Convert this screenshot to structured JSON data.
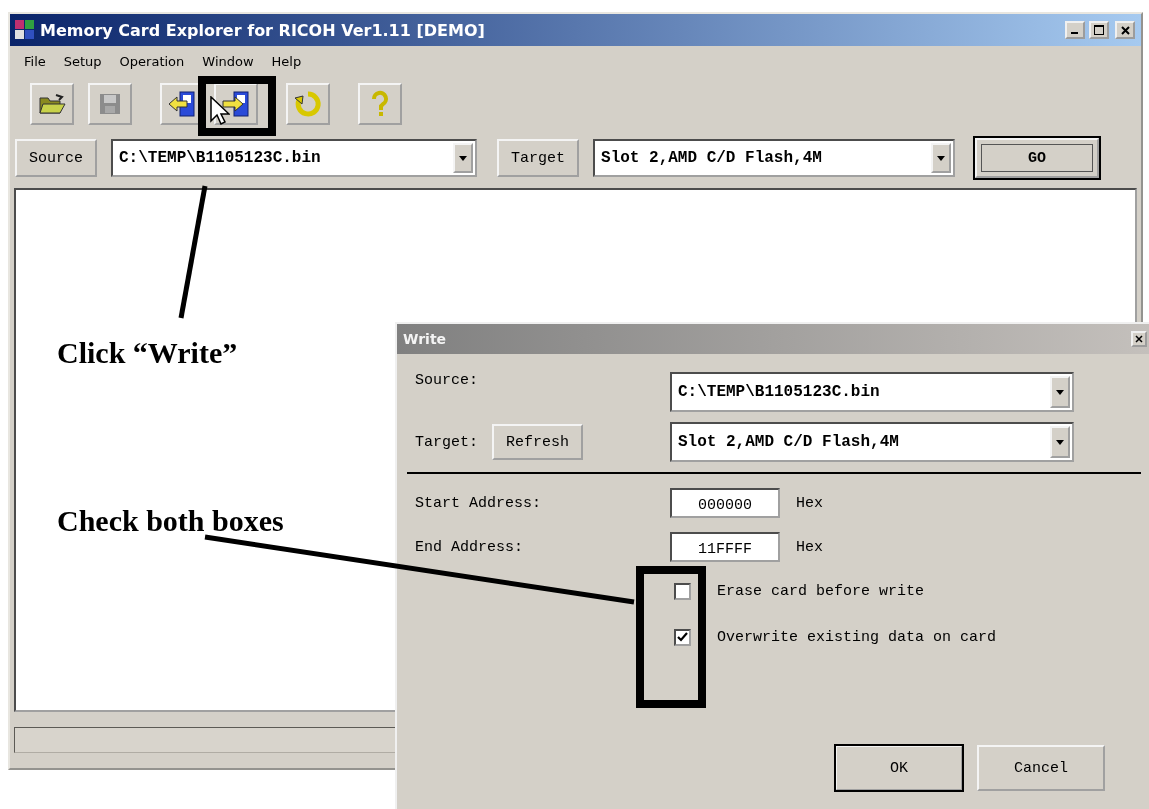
{
  "window": {
    "title": "Memory Card Explorer for RICOH Ver1.11 [DEMO]"
  },
  "menu": [
    "File",
    "Setup",
    "Operation",
    "Window",
    "Help"
  ],
  "toolbar": [
    {
      "disabled": false
    },
    {
      "disabled": true
    },
    {
      "disabled": false
    },
    {
      "disabled": false
    },
    {
      "disabled": false
    },
    {
      "disabled": false
    }
  ],
  "source_row": {
    "source_button": "Source",
    "source_value": "C:\\TEMP\\B1105123C.bin",
    "target_button": "Target",
    "target_value": "Slot 2,AMD C/D Flash,4M",
    "go_button": {
      "label": "GO",
      "default": true
    }
  },
  "dialog": {
    "title": "Write",
    "source_label": "Source:",
    "source_value": "C:\\TEMP\\B1105123C.bin",
    "target_label": "Target:",
    "refresh_button": "Refresh",
    "target_value": "Slot 2,AMD C/D Flash,4M",
    "start_label": "Start Address:",
    "start_value": "000000",
    "start_unit": "Hex",
    "end_label": "End Address:",
    "end_value": "11FFFF",
    "end_unit": "Hex",
    "options": [
      {
        "label": "Erase card before write",
        "checked": false
      },
      {
        "label": "Overwrite existing data on card",
        "checked": true
      }
    ],
    "buttons": [
      {
        "label": "OK",
        "default": true
      },
      {
        "label": "Cancel",
        "default": false
      }
    ]
  },
  "annotations": [
    {
      "text": "Click “Write”"
    },
    {
      "text": "Check both boxes"
    }
  ]
}
